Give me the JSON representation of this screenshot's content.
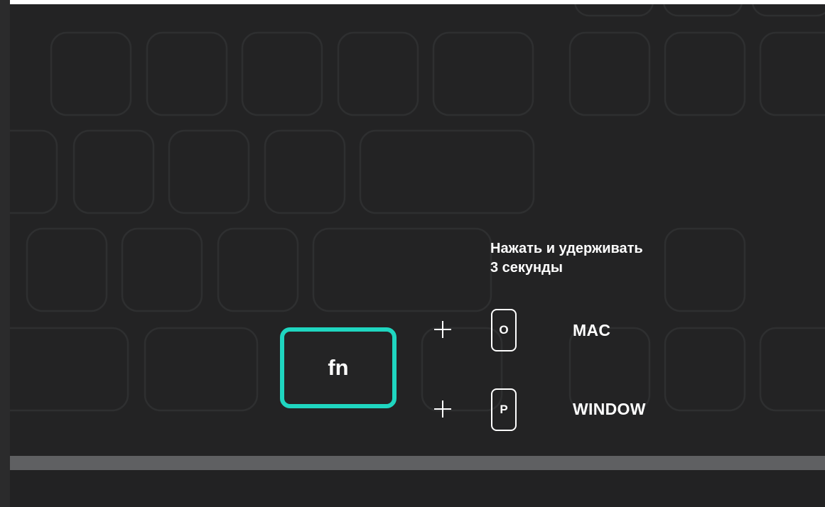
{
  "instruction": {
    "line1": "Нажать и удерживать",
    "line2": "3 секунды"
  },
  "fn_key": {
    "label": "fn",
    "highlight_color": "#1fd6c0"
  },
  "combos": [
    {
      "plus": "+",
      "key": "O",
      "os": "MAC"
    },
    {
      "plus": "+",
      "key": "P",
      "os": "WINDOW"
    }
  ],
  "colors": {
    "panel": "#232324",
    "key_outline": "#2e2f30",
    "bottom_bar": "#5f6062",
    "text": "#ffffff"
  }
}
